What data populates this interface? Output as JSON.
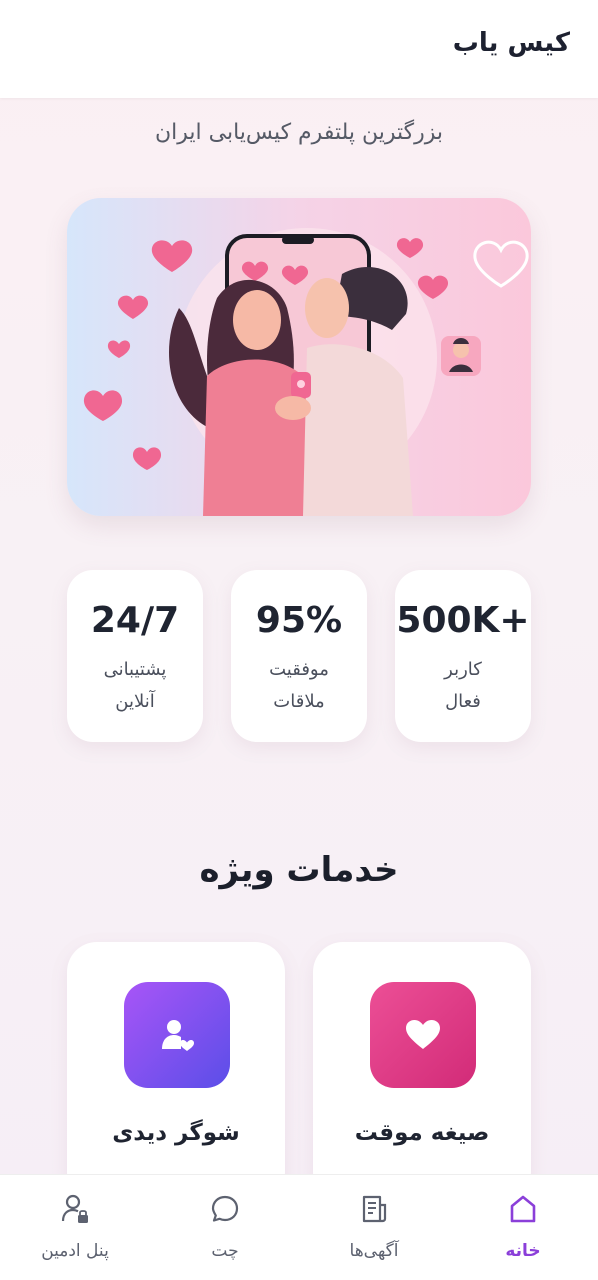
{
  "app": {
    "title": "کیس یاب"
  },
  "hero": {
    "tagline": "بزرگترین پلتفرم کیس‌یابی ایران"
  },
  "stats": [
    {
      "value": "500K+",
      "label_line1": "کاربر",
      "label_line2": "فعال"
    },
    {
      "value": "95%",
      "label_line1": "موفقیت",
      "label_line2": "ملاقات"
    },
    {
      "value": "24/7",
      "label_line1": "پشتیبانی",
      "label_line2": "آنلاین"
    }
  ],
  "services": {
    "title": "خدمات ویژه",
    "items": [
      {
        "label": "صیغه موقت",
        "icon": "heart-icon"
      },
      {
        "label": "شوگر دیدی",
        "icon": "user-heart-icon"
      }
    ]
  },
  "nav": {
    "items": [
      {
        "label": "خانه",
        "icon": "home-icon",
        "active": true
      },
      {
        "label": "آگهی‌ها",
        "icon": "listing-icon",
        "active": false
      },
      {
        "label": "چت",
        "icon": "chat-icon",
        "active": false
      },
      {
        "label": "پنل ادمین",
        "icon": "admin-user-icon",
        "active": false
      }
    ]
  },
  "colors": {
    "accent": "#8b3fd9",
    "pink": "#e63f89",
    "purple_gradient_start": "#a855f7",
    "purple_gradient_end": "#5b4ee8"
  }
}
